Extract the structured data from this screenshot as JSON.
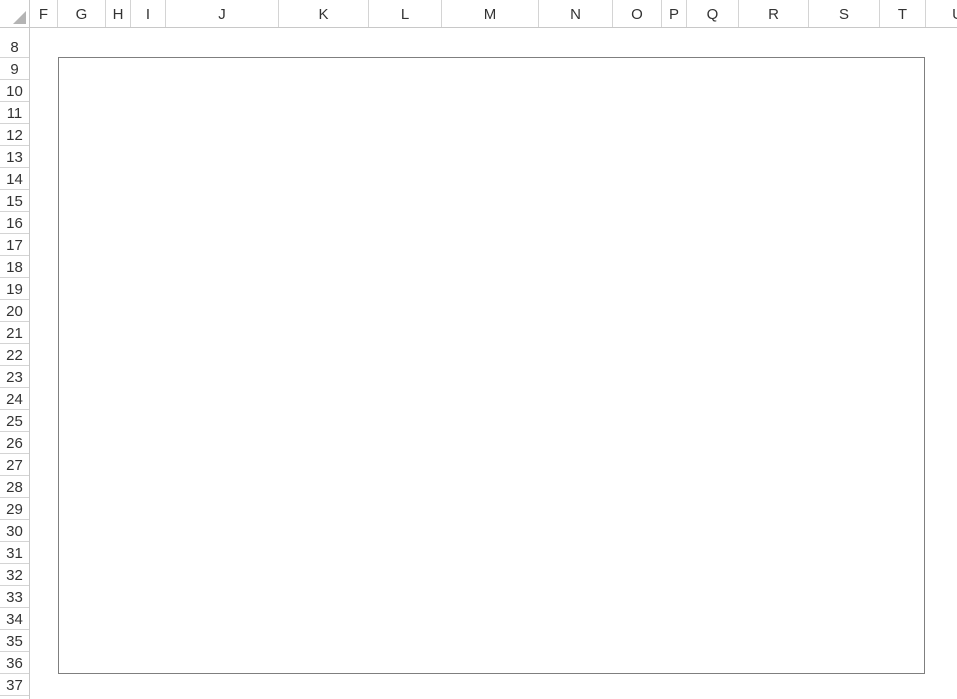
{
  "column_header": {
    "columns": [
      "F",
      "G",
      "H",
      "I",
      "J",
      "K",
      "L",
      "M",
      "N",
      "O",
      "P",
      "Q",
      "R",
      "S",
      "T",
      "U"
    ]
  },
  "row_header": {
    "rows": [
      "8",
      "9",
      "10",
      "11",
      "12",
      "13",
      "14",
      "15",
      "16",
      "17",
      "18",
      "19",
      "20",
      "21",
      "22",
      "23",
      "24",
      "25",
      "26",
      "27",
      "28",
      "29",
      "30",
      "31",
      "32",
      "33",
      "34",
      "35",
      "36",
      "37"
    ]
  },
  "colors": {
    "header_text": "#333333",
    "gridline": "#d4d4d4",
    "chart_border": "#7f7f7f",
    "background": "#ffffff"
  }
}
